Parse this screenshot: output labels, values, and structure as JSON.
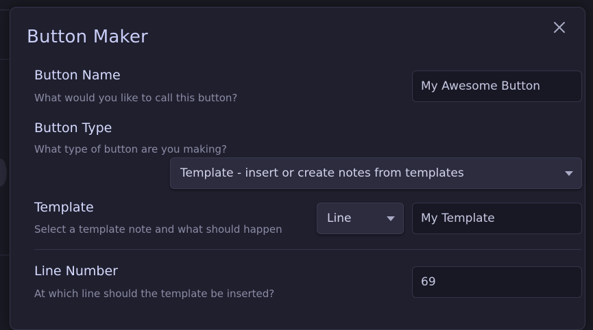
{
  "modal": {
    "title": "Button Maker"
  },
  "fields": {
    "button_name": {
      "label": "Button Name",
      "description": "What would you like to call this button?",
      "value": "My Awesome Button"
    },
    "button_type": {
      "label": "Button Type",
      "description": "What type of button are you making?",
      "selected": "Template - insert or create notes from templates"
    },
    "template": {
      "label": "Template",
      "description": "Select a template note and what should happen",
      "action_selected": "Line",
      "note_value": "My Template"
    },
    "line_number": {
      "label": "Line Number",
      "description": "At which line should the template be inserted?",
      "value": "69"
    }
  },
  "icons": {
    "close": "close-icon",
    "dropdown": "chevron-down-icon"
  },
  "colors": {
    "background": "#1a1a24",
    "modal": "#1f1f2e",
    "title": "#c9cdf6",
    "label": "#d6dbff",
    "description": "#8b8ca5"
  }
}
